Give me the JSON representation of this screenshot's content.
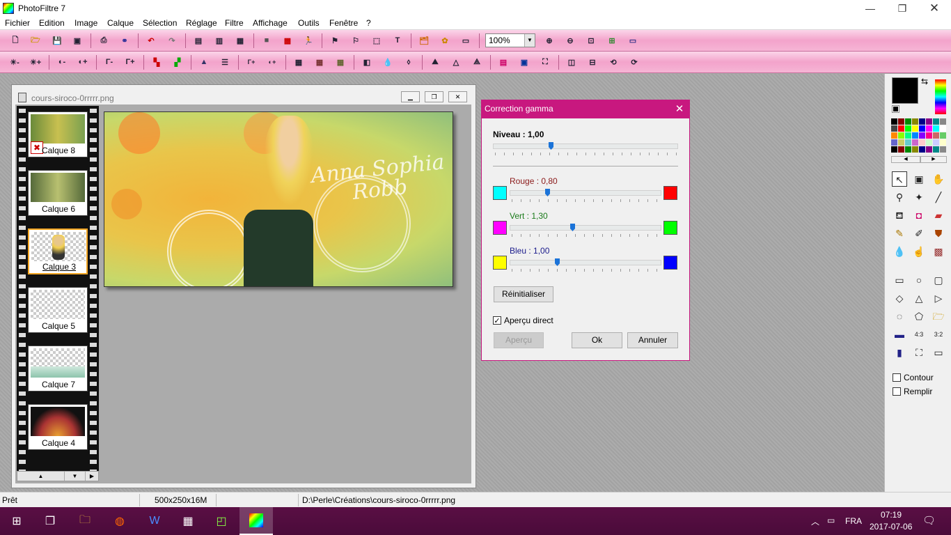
{
  "app": {
    "title": "PhotoFiltre 7"
  },
  "menu": [
    "Fichier",
    "Edition",
    "Image",
    "Calque",
    "Sélection",
    "Réglage",
    "Filtre",
    "Affichage",
    "Outils",
    "Fenêtre",
    "?"
  ],
  "toolbar": {
    "zoom": "100%"
  },
  "image_window": {
    "title": "cours-siroco-0rrrrr.png"
  },
  "layers": [
    "Calque 8",
    "Calque 6",
    "Calque 3",
    "Calque 5",
    "Calque 7",
    "Calque 4"
  ],
  "selected_layer": "Calque 3",
  "photo_text": [
    "Anna Sophia",
    "Robb"
  ],
  "dialog": {
    "title": "Correction gamma",
    "level_label": "Niveau : 1,00",
    "level_value": 1.0,
    "red_label": "Rouge : 0,80",
    "green_label": "Vert : 1,30",
    "blue_label": "Bleu : 1,00",
    "reset": "Réinitialiser",
    "live_preview": "Aperçu direct",
    "preview": "Aperçu",
    "ok": "Ok",
    "cancel": "Annuler",
    "colors": {
      "cyan": "#00ffff",
      "red": "#ff0000",
      "magenta": "#ff00ff",
      "green": "#00ff00",
      "yellow": "#ffff00",
      "blue": "#0000ff"
    }
  },
  "panel": {
    "outline": "Contour",
    "fill": "Remplir"
  },
  "status": {
    "ready": "Prêt",
    "size": "500x250x16M",
    "path": "D:\\Perle\\Créations\\cours-siroco-0rrrrr.png"
  },
  "taskbar": {
    "lang": "FRA",
    "time": "07:19",
    "date": "2017-07-06"
  }
}
